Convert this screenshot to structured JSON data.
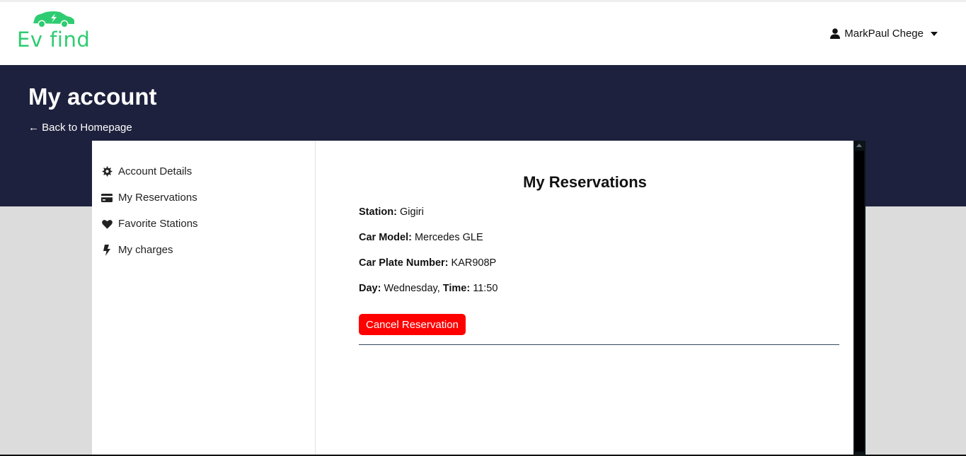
{
  "header": {
    "logo_text": "Ev find",
    "logo_icon": "car-bolt-icon",
    "user_name": "MarkPaul Chege",
    "brand_color": "#2ecc71"
  },
  "hero": {
    "title": "My account",
    "back_link": "← Back to Homepage",
    "background": "#1e213d"
  },
  "sidebar": {
    "items": [
      {
        "label": "Account Details",
        "icon": "gear-icon"
      },
      {
        "label": "My Reservations",
        "icon": "credit-card-icon"
      },
      {
        "label": "Favorite Stations",
        "icon": "heart-icon"
      },
      {
        "label": "My charges",
        "icon": "bolt-icon"
      }
    ]
  },
  "reservations": {
    "title": "My Reservations",
    "station_label": "Station:",
    "station": "Gigiri",
    "car_model_label": "Car Model:",
    "car_model": "Mercedes GLE",
    "plate_label": "Car Plate Number:",
    "plate": "KAR908P",
    "day_label": "Day:",
    "day": "Wednesday,",
    "time_label": "Time:",
    "time": "11:50",
    "cancel_button": "Cancel Reservation",
    "cancel_color": "#ff0000"
  }
}
